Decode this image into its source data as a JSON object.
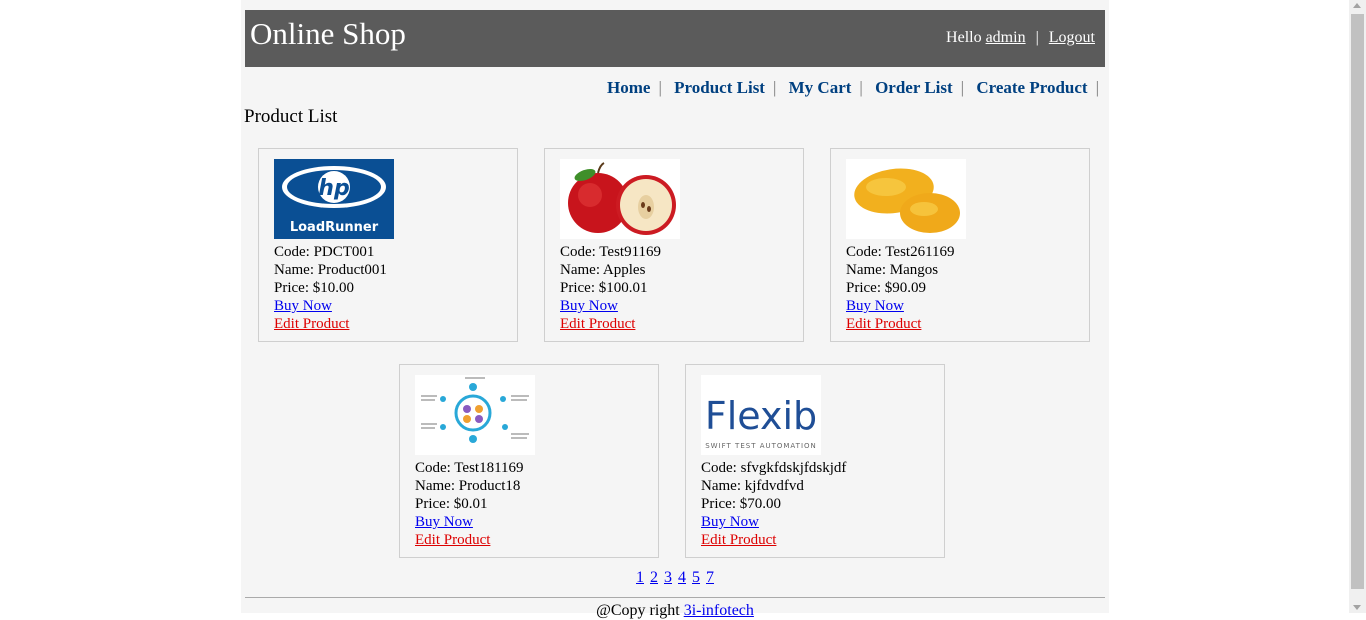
{
  "header": {
    "title": "Online Shop",
    "greeting": "Hello",
    "username": "admin",
    "separator": "|",
    "logout": "Logout"
  },
  "menu": {
    "home": "Home",
    "product_list": "Product List",
    "my_cart": "My Cart",
    "order_list": "Order List",
    "create_product": "Create Product",
    "separator": "|"
  },
  "page_title": "Product List",
  "products": [
    {
      "code": "Code: PDCT001",
      "name": "Name: Product001",
      "price": "Price: $10.00",
      "buy": "Buy Now",
      "edit": "Edit Product",
      "image_icon": "hp-loadrunner-logo",
      "logo_text": "LoadRunner"
    },
    {
      "code": "Code: Test91169",
      "name": "Name: Apples",
      "price": "Price: $100.01",
      "buy": "Buy Now",
      "edit": "Edit Product",
      "image_icon": "apple-image"
    },
    {
      "code": "Code: Test261169",
      "name": "Name: Mangos",
      "price": "Price: $90.09",
      "buy": "Buy Now",
      "edit": "Edit Product",
      "image_icon": "mango-image"
    },
    {
      "code": "Code: Test181169",
      "name": "Name: Product18",
      "price": "Price: $0.01",
      "buy": "Buy Now",
      "edit": "Edit Product",
      "image_icon": "diagram-image"
    },
    {
      "code": "Code: sfvgkfdskjfdskjdf",
      "name": "Name: kjfdvdfvd",
      "price": "Price: $70.00",
      "buy": "Buy Now",
      "edit": "Edit Product",
      "image_icon": "flexib-logo",
      "logo_text": "Flexib",
      "logo_tagline": "SWIFT TEST AUTOMATION"
    }
  ],
  "pagination": [
    "1",
    "2",
    "3",
    "4",
    "5",
    "7"
  ],
  "footer": {
    "copyright": "@Copy right",
    "company": "3i-infotech"
  },
  "colors": {
    "header_bg": "#5b5b5b",
    "menu_link": "#004080",
    "buy_link": "#0000ee",
    "edit_link": "#dd0000"
  }
}
